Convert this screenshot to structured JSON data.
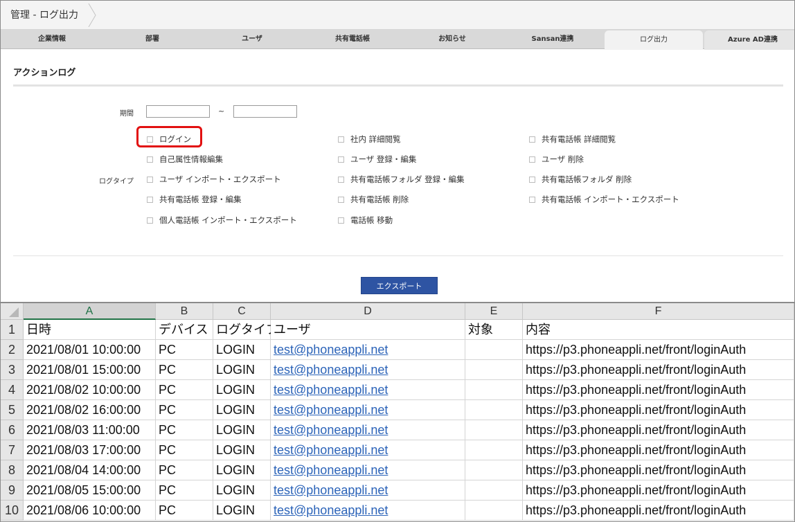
{
  "breadcrumb": "管理 - ログ出力",
  "tabs": [
    {
      "label": "企業情報"
    },
    {
      "label": "部署"
    },
    {
      "label": "ユーザ"
    },
    {
      "label": "共有電話帳"
    },
    {
      "label": "お知らせ"
    },
    {
      "label": "Sansan連携"
    },
    {
      "label": "ログ出力"
    },
    {
      "label": "Azure AD連携"
    }
  ],
  "active_tab": "ログ出力",
  "section_title": "アクションログ",
  "period": {
    "label": "期間",
    "separator": "~",
    "from_value": "",
    "to_value": ""
  },
  "log_type_label": "ログタイプ",
  "log_types": [
    [
      "ログイン",
      "社内 詳細閲覧",
      "共有電話帳 詳細閲覧"
    ],
    [
      "自己属性情報編集",
      "ユーザ 登録・編集",
      "ユーザ 削除"
    ],
    [
      "ユーザ インポート・エクスポート",
      "共有電話帳フォルダ 登録・編集",
      "共有電話帳フォルダ 削除"
    ],
    [
      "共有電話帳 登録・編集",
      "共有電話帳 削除",
      "共有電話帳 インポート・エクスポート"
    ],
    [
      "個人電話帳 インポート・エクスポート",
      "電話帳 移動",
      ""
    ]
  ],
  "export_button": "エクスポート",
  "spreadsheet": {
    "columns": [
      "A",
      "B",
      "C",
      "D",
      "E",
      "F"
    ],
    "selected_column": "A",
    "rows": [
      {
        "n": "1",
        "cells": [
          "日時",
          "デバイス",
          "ログタイプ",
          "ユーザ",
          "対象",
          "内容"
        ]
      },
      {
        "n": "2",
        "cells": [
          "2021/08/01 10:00:00",
          "PC",
          "LOGIN",
          "test@phoneappli.net",
          "",
          "https://p3.phoneappli.net/front/loginAuth"
        ]
      },
      {
        "n": "3",
        "cells": [
          "2021/08/01 15:00:00",
          "PC",
          "LOGIN",
          "test@phoneappli.net",
          "",
          "https://p3.phoneappli.net/front/loginAuth"
        ]
      },
      {
        "n": "4",
        "cells": [
          "2021/08/02 10:00:00",
          "PC",
          "LOGIN",
          "test@phoneappli.net",
          "",
          "https://p3.phoneappli.net/front/loginAuth"
        ]
      },
      {
        "n": "5",
        "cells": [
          "2021/08/02 16:00:00",
          "PC",
          "LOGIN",
          "test@phoneappli.net",
          "",
          "https://p3.phoneappli.net/front/loginAuth"
        ]
      },
      {
        "n": "6",
        "cells": [
          "2021/08/03 11:00:00",
          "PC",
          "LOGIN",
          "test@phoneappli.net",
          "",
          "https://p3.phoneappli.net/front/loginAuth"
        ]
      },
      {
        "n": "7",
        "cells": [
          "2021/08/03 17:00:00",
          "PC",
          "LOGIN",
          "test@phoneappli.net",
          "",
          "https://p3.phoneappli.net/front/loginAuth"
        ]
      },
      {
        "n": "8",
        "cells": [
          "2021/08/04 14:00:00",
          "PC",
          "LOGIN",
          "test@phoneappli.net",
          "",
          "https://p3.phoneappli.net/front/loginAuth"
        ]
      },
      {
        "n": "9",
        "cells": [
          "2021/08/05 15:00:00",
          "PC",
          "LOGIN",
          "test@phoneappli.net",
          "",
          "https://p3.phoneappli.net/front/loginAuth"
        ]
      },
      {
        "n": "10",
        "cells": [
          "2021/08/06 10:00:00",
          "PC",
          "LOGIN",
          "test@phoneappli.net",
          "",
          "https://p3.phoneappli.net/front/loginAuth"
        ]
      }
    ]
  },
  "colors": {
    "export_button": "#2e54a3",
    "highlight": "#e21010",
    "link": "#2b63b8",
    "selected_column": "#217346"
  }
}
